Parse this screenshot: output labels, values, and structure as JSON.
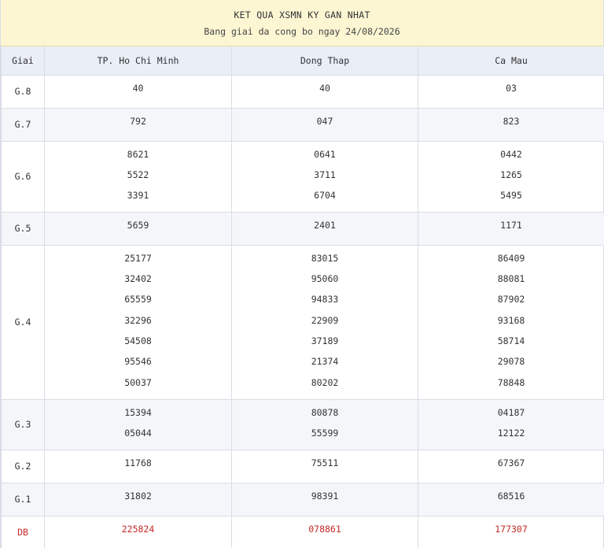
{
  "header": {
    "title": "KET QUA XSMN KY GAN NHAT",
    "subtitle": "Bang giai da cong bo ngay 24/08/2026"
  },
  "table": {
    "columns": [
      "Giai",
      "TP. Ho Chi Minh",
      "Dong Thap",
      "Ca Mau"
    ],
    "rows": [
      {
        "label": "G.8",
        "values": [
          [
            "40"
          ],
          [
            "40"
          ],
          [
            "03"
          ]
        ]
      },
      {
        "label": "G.7",
        "values": [
          [
            "792"
          ],
          [
            "047"
          ],
          [
            "823"
          ]
        ]
      },
      {
        "label": "G.6",
        "values": [
          [
            "8621",
            "5522",
            "3391"
          ],
          [
            "0641",
            "3711",
            "6704"
          ],
          [
            "0442",
            "1265",
            "5495"
          ]
        ]
      },
      {
        "label": "G.5",
        "values": [
          [
            "5659"
          ],
          [
            "2401"
          ],
          [
            "1171"
          ]
        ]
      },
      {
        "label": "G.4",
        "values": [
          [
            "25177",
            "32402",
            "65559",
            "32296",
            "54508",
            "95546",
            "50037"
          ],
          [
            "83015",
            "95060",
            "94833",
            "22909",
            "37189",
            "21374",
            "80202"
          ],
          [
            "86409",
            "88081",
            "87902",
            "93168",
            "58714",
            "29078",
            "78848"
          ]
        ]
      },
      {
        "label": "G.3",
        "values": [
          [
            "15394",
            "05044"
          ],
          [
            "80878",
            "55599"
          ],
          [
            "04187",
            "12122"
          ]
        ]
      },
      {
        "label": "G.2",
        "values": [
          [
            "11768"
          ],
          [
            "75511"
          ],
          [
            "67367"
          ]
        ]
      },
      {
        "label": "G.1",
        "values": [
          [
            "31802"
          ],
          [
            "98391"
          ],
          [
            "68516"
          ]
        ]
      },
      {
        "label": "DB",
        "values": [
          [
            "225824"
          ],
          [
            "078861"
          ],
          [
            "177307"
          ]
        ]
      }
    ]
  },
  "colors": {
    "header_bg": "#fdf6d3",
    "alt_row_bg": "#f4f6fa",
    "special_prize": "#c62828"
  }
}
